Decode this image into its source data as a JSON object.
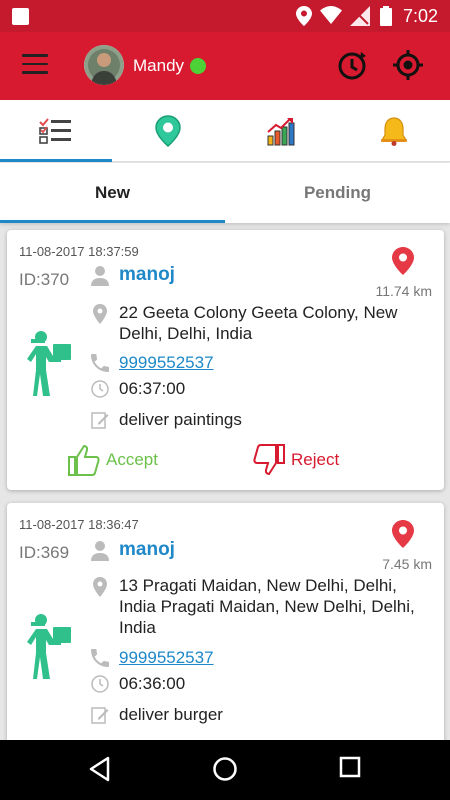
{
  "statusbar": {
    "time": "7:02"
  },
  "user": {
    "name": "Mandy",
    "status_color": "#4cd137"
  },
  "colors": {
    "brand": "#d71a2f",
    "accent": "#1e88c8",
    "accept": "#6bc14a"
  },
  "tabs": [
    "task-list",
    "map-location",
    "stats-chart",
    "notifications-bell"
  ],
  "subtabs": {
    "new": "New",
    "pending": "Pending"
  },
  "orders": [
    {
      "date": "11-08-2017 18:37:59",
      "id": "ID:370",
      "distance": "11.74 km",
      "name": "manoj",
      "address": "22 Geeta Colony Geeta Colony, New Delhi, Delhi, India",
      "phone": "9999552537",
      "time": "06:37:00",
      "note": "deliver paintings",
      "accept": "Accept",
      "reject": "Reject"
    },
    {
      "date": "11-08-2017 18:36:47",
      "id": "ID:369",
      "distance": "7.45 km",
      "name": "manoj",
      "address": "13 Pragati Maidan, New Delhi, Delhi, India Pragati Maidan, New Delhi, Delhi, India",
      "phone": "9999552537",
      "time": "06:36:00",
      "note": "deliver burger"
    }
  ]
}
